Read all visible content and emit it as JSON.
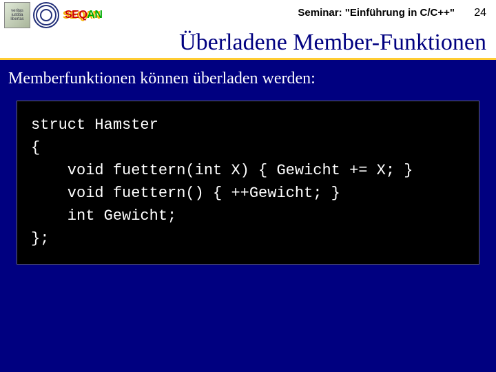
{
  "header": {
    "logos": {
      "university_motto": "veritas iustitia libertas",
      "seqan_seq": "SEQ",
      "seqan_an": "AN"
    },
    "seminar_label": "Seminar: \"Einführung in C/C++\"",
    "page_number": "24"
  },
  "title": "Überladene Member-Funktionen",
  "intro_text": "Memberfunktionen können überladen werden:",
  "code": "struct Hamster\n{\n    void fuettern(int X) { Gewicht += X; }\n    void fuettern() { ++Gewicht; }\n    int Gewicht;\n};"
}
